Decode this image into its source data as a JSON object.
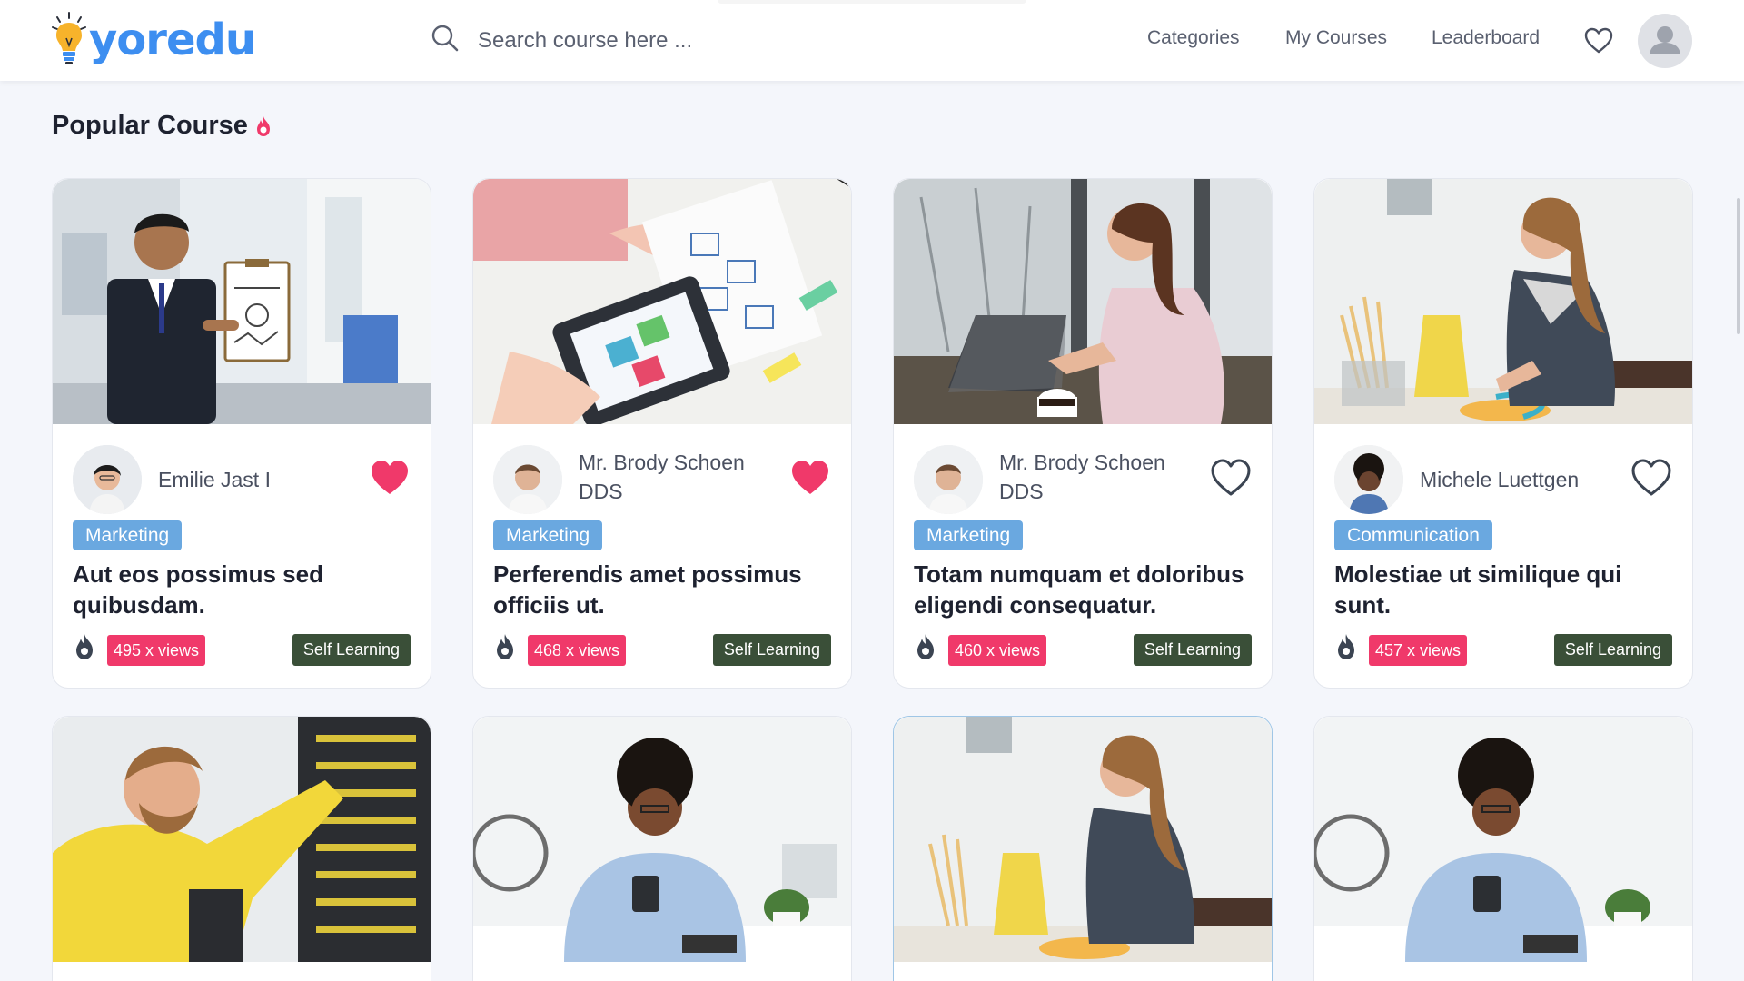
{
  "header": {
    "logo_text": "yoredu",
    "search_placeholder": "Search course here ...",
    "nav": {
      "categories": "Categories",
      "my_courses": "My Courses",
      "leaderboard": "Leaderboard"
    }
  },
  "section": {
    "title": "Popular Course"
  },
  "colors": {
    "brand_blue": "#3d8ef0",
    "favorite_pink": "#f0396a",
    "category_blue": "#6aa8e0",
    "badge_green": "#3a4f38"
  },
  "courses": [
    {
      "author": "Emilie Jast I",
      "category": "Marketing",
      "title": "Aut eos possimus sed quibusdam.",
      "views": "495 x views",
      "type": "Self Learning",
      "favorite": true
    },
    {
      "author": "Mr. Brody Schoen DDS",
      "category": "Marketing",
      "title": "Perferendis amet possimus officiis ut.",
      "views": "468 x views",
      "type": "Self Learning",
      "favorite": true
    },
    {
      "author": "Mr. Brody Schoen DDS",
      "category": "Marketing",
      "title": "Totam numquam et doloribus eligendi consequatur.",
      "views": "460 x views",
      "type": "Self Learning",
      "favorite": false
    },
    {
      "author": "Michele Luettgen",
      "category": "Communication",
      "title": "Molestiae ut similique qui sunt.",
      "views": "457 x views",
      "type": "Self Learning",
      "favorite": false
    }
  ]
}
